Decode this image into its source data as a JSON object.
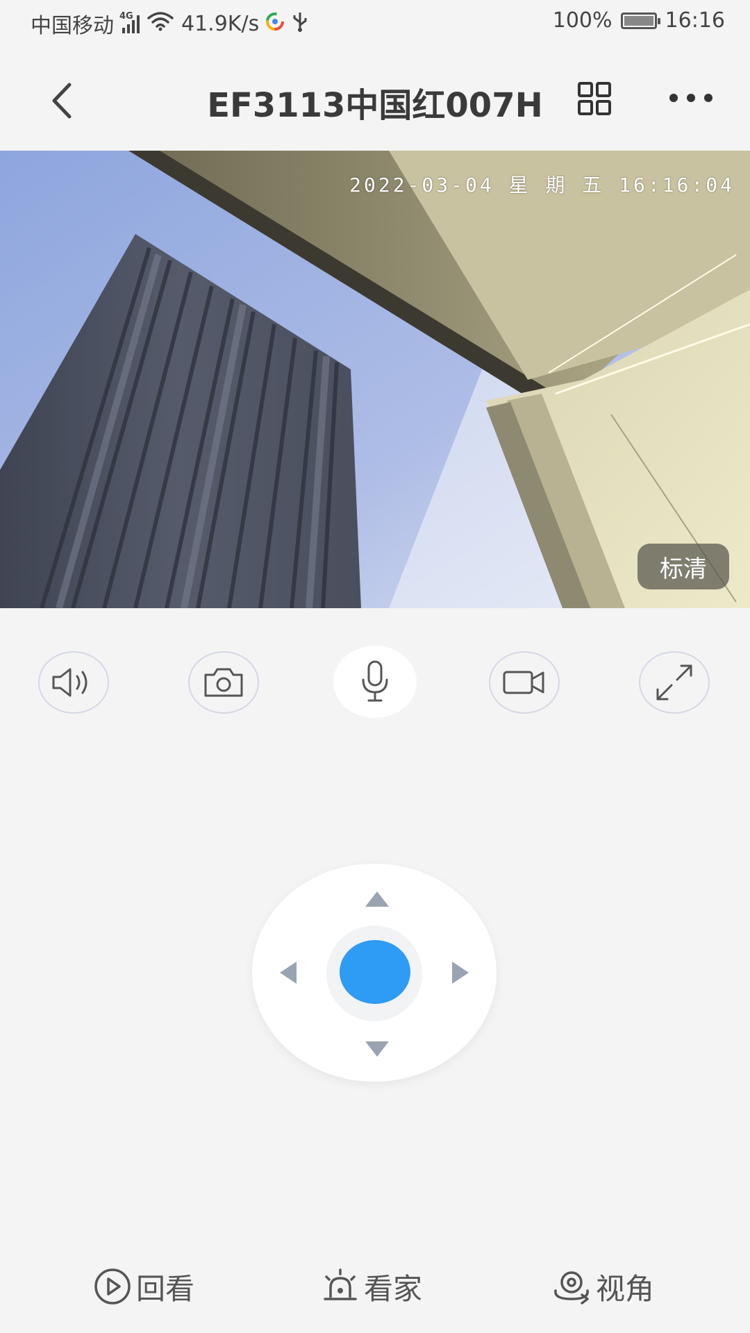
{
  "status_bar": {
    "carrier": "中国移动",
    "network": "4G",
    "speed": "41.9K/s",
    "battery": "100%",
    "battery_level": 1.0,
    "time": "16:16",
    "icons": [
      "signal-icon",
      "wifi-icon",
      "app-notification-icon",
      "usb-icon",
      "battery-icon"
    ]
  },
  "header": {
    "title": "EF3113中国红007H",
    "icons": [
      "back-icon",
      "grid-icon",
      "more-icon"
    ]
  },
  "video": {
    "timestamp": "2022-03-04 星 期 五 16:16:04",
    "quality": "标清"
  },
  "controls": [
    {
      "name": "speaker",
      "icon": "speaker-icon"
    },
    {
      "name": "snapshot",
      "icon": "camera-icon"
    },
    {
      "name": "talk",
      "icon": "microphone-icon",
      "active": true
    },
    {
      "name": "record",
      "icon": "video-record-icon"
    },
    {
      "name": "fullscreen",
      "icon": "expand-icon"
    }
  ],
  "joystick": {
    "icons": [
      "arrow-up-icon",
      "arrow-down-icon",
      "arrow-left-icon",
      "arrow-right-icon"
    ],
    "knob_color": "#2e9bf5"
  },
  "bottom_nav": {
    "playback": "回看",
    "home_watch": "看家",
    "view_angle": "视角"
  },
  "colors": {
    "accent": "#2e9bf5",
    "background": "#f4f4f5"
  }
}
